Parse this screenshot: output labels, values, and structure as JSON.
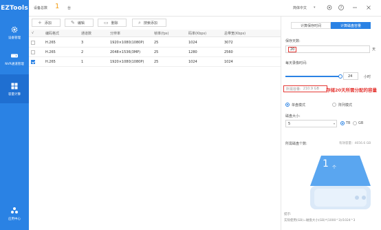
{
  "app": {
    "logo": "EZTools"
  },
  "sidebar": {
    "items": [
      {
        "label": "设备管理",
        "icon": "gear-icon",
        "active": false
      },
      {
        "label": "NVR通道管理",
        "icon": "nvr-icon",
        "active": false
      },
      {
        "label": "容量计算",
        "icon": "calculator-icon",
        "active": true
      },
      {
        "label": "应用中心",
        "icon": "apps-icon",
        "active": false
      }
    ]
  },
  "topbar": {
    "device_count_label": "设备总数",
    "device_count": "1",
    "device_count_unit": "台",
    "language": "简体中文",
    "icons": [
      "settings-icon",
      "help-icon",
      "minimize-icon",
      "close-icon"
    ]
  },
  "toolbar": {
    "add": "添加",
    "edit": "编辑",
    "delete": "删除",
    "search_add": "搜索添加"
  },
  "table": {
    "headers": [
      "编码格式",
      "通道数",
      "分辨率",
      "帧率(fps)",
      "码率(Kbps)",
      "总带宽(Kbps)"
    ],
    "rows": [
      {
        "checked": false,
        "cells": [
          "H.265",
          "3",
          "1920×1080(1080P)",
          "25",
          "1024",
          "3072"
        ]
      },
      {
        "checked": false,
        "cells": [
          "H.265",
          "2",
          "2048×1536(3MP)",
          "25",
          "1280",
          "2560"
        ]
      },
      {
        "checked": true,
        "cells": [
          "H.265",
          "1",
          "1920×1080(1080P)",
          "25",
          "1024",
          "1024"
        ]
      }
    ]
  },
  "panel": {
    "tab_time": "计算保存时间",
    "tab_disk": "计算磁盘容量",
    "days_label": "保存天数:",
    "days_value": "20",
    "days_unit": "天",
    "hours_label": "每天录像时间:",
    "hours_value": "24",
    "hours_unit": "小时",
    "hours_fraction": 1.0,
    "required_label": "所需容量:",
    "required_value": "210.9 GB",
    "callout": "存储20天所需分配的容量",
    "mode_single": "单盘模式",
    "mode_raid": "阵列模式",
    "disk_size_label": "磁盘大小:",
    "disk_size_value": "5",
    "unit_tb": "TB",
    "unit_gb": "GB",
    "disk_count_label": "所需磁盘个数:",
    "effective_capacity": "有效容量：4656.6 GB",
    "disk_count": "1",
    "disk_unit": "个",
    "tip_title": "提示:",
    "tip_formula": "实际使用(GB)=磁盘大小(GB)*(1000^3)/1024^3"
  },
  "colors": {
    "brand": "#2a82e4",
    "highlight": "#e53935",
    "count": "#f39c12"
  }
}
